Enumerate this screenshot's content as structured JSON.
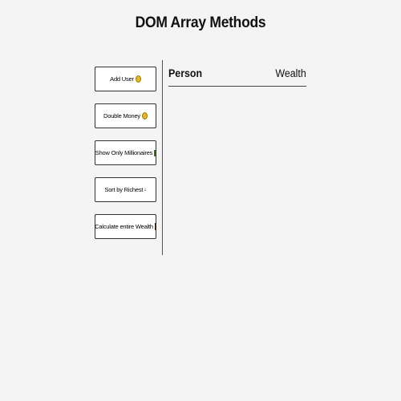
{
  "header": {
    "title": "DOM Array Methods"
  },
  "controls": {
    "add_user": {
      "label": "Add User",
      "icon": "coin-icon"
    },
    "double_money": {
      "label": "Double Money",
      "icon": "coin-icon"
    },
    "show_millionaires": {
      "label": "Show Only Millionaires",
      "icon": "money-icon"
    },
    "sort_richest": {
      "label": "Sort by Richest",
      "icon": "arrow-down-icon",
      "icon_glyph": "↓"
    },
    "calculate_wealth": {
      "label": "Calculate entire Wealth",
      "icon": "chart-icon"
    }
  },
  "list": {
    "header_person": "Person",
    "header_wealth": "Wealth",
    "rows": []
  }
}
